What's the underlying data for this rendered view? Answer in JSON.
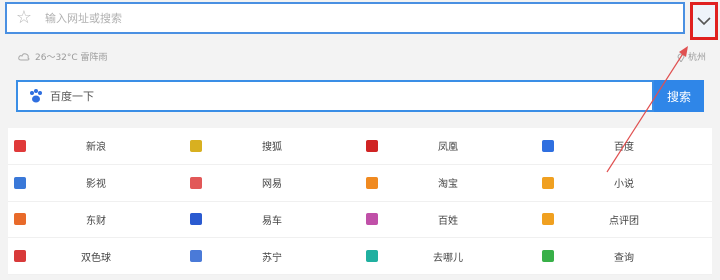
{
  "address_bar": {
    "placeholder": "输入网址或搜索"
  },
  "weather": {
    "text": "26～32°C 雷阵雨"
  },
  "location": {
    "city": "杭州"
  },
  "search": {
    "value": "百度一下",
    "button_label": "搜索"
  },
  "links": [
    {
      "label": "新浪",
      "icon": "sina-icon",
      "color": "#e03a3a"
    },
    {
      "label": "搜狐",
      "icon": "sohu-icon",
      "color": "#d8b020"
    },
    {
      "label": "凤凰",
      "icon": "ifeng-icon",
      "color": "#d02424"
    },
    {
      "label": "百度",
      "icon": "baidu-icon",
      "color": "#2f6fe0"
    },
    {
      "label": "影视",
      "icon": "video-icon",
      "color": "#3a78d8"
    },
    {
      "label": "网易",
      "icon": "netease-icon",
      "color": "#e25858"
    },
    {
      "label": "淘宝",
      "icon": "taobao-icon",
      "color": "#f08a20"
    },
    {
      "label": "小说",
      "icon": "novel-icon",
      "color": "#f0a020"
    },
    {
      "label": "东财",
      "icon": "eastmoney-icon",
      "color": "#e86a2a"
    },
    {
      "label": "易车",
      "icon": "yiche-icon",
      "color": "#2a5ad0"
    },
    {
      "label": "百姓",
      "icon": "baixing-icon",
      "color": "#c050a8"
    },
    {
      "label": "点评团",
      "icon": "dianping-icon",
      "color": "#f0a020"
    },
    {
      "label": "双色球",
      "icon": "lottery-icon",
      "color": "#d83a3a"
    },
    {
      "label": "苏宁",
      "icon": "suning-icon",
      "color": "#4a7ad8"
    },
    {
      "label": "去哪儿",
      "icon": "qunar-icon",
      "color": "#20b0a0"
    },
    {
      "label": "查询",
      "icon": "query-icon",
      "color": "#38b048"
    }
  ],
  "colors": {
    "accent": "#2f86e8",
    "highlight": "#e02020"
  }
}
